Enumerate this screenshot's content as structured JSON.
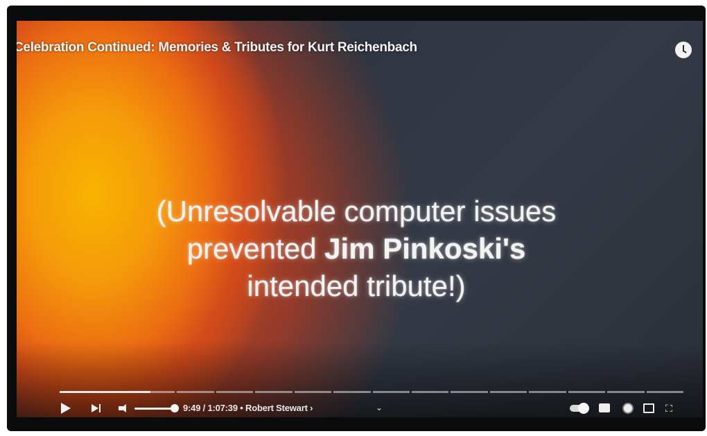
{
  "video": {
    "title": "Celebration Continued: Memories & Tributes for Kurt Reichenbach",
    "overlay_line1": "(Unresolvable computer issues",
    "overlay_line2_pre": "prevented ",
    "overlay_line2_bold": "Jim Pinkoski's",
    "overlay_line3": "intended tribute!)"
  },
  "player": {
    "time_label": "9:49 / 1:07:39 • Robert Stewart ›",
    "chapter_chevron": "⌄",
    "progress_fraction": 0.145,
    "volume_fraction": 1.0,
    "autoplay_on": true,
    "fullscreen_glyph": "⛶",
    "icons": [
      "play-icon",
      "next-icon",
      "volume-icon",
      "watch-later-icon",
      "autoplay-toggle",
      "cc-icon",
      "gear-icon",
      "cast-icon",
      "fullscreen-icon"
    ]
  },
  "colors": {
    "accent_white": "#f0f0f0",
    "screen_dark": "#2f3440",
    "sun_orange": "#ec6d12"
  }
}
